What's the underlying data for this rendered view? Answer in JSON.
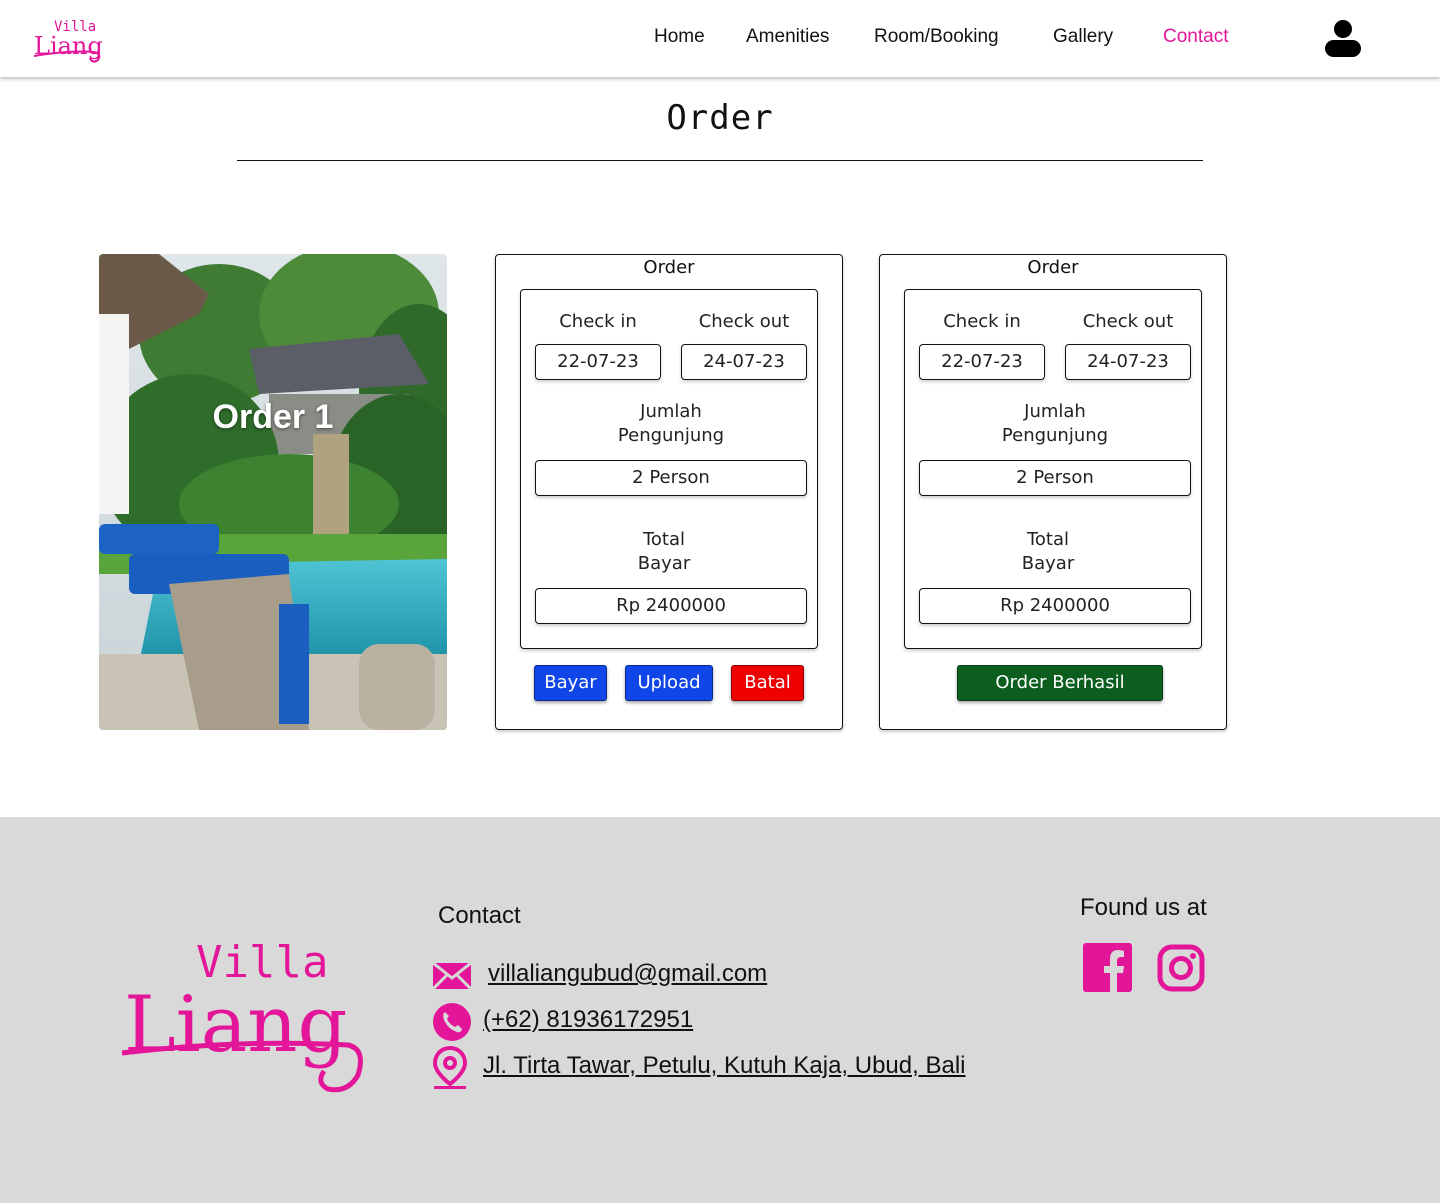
{
  "brand": {
    "logo_line1": "Villa",
    "logo_line2": "Liang",
    "accent": "#e3169a"
  },
  "nav": {
    "items": [
      {
        "label": "Home"
      },
      {
        "label": "Amenities"
      },
      {
        "label": "Room/Booking"
      },
      {
        "label": "Gallery"
      },
      {
        "label": "Contact"
      }
    ],
    "active": "Contact",
    "user_icon": "user-icon"
  },
  "page": {
    "title": "Order"
  },
  "image_card": {
    "label": "Order 1",
    "image": "villa-pool-photo"
  },
  "orders": [
    {
      "title": "Order",
      "check_in_label": "Check in",
      "check_out_label": "Check out",
      "check_in": "22-07-23",
      "check_out": "24-07-23",
      "guests_label_1": "Jumlah",
      "guests_label_2": "Pengunjung",
      "guests": "2 Person",
      "total_label_1": "Total",
      "total_label_2": "Bayar",
      "total": "Rp 2400000",
      "buttons": [
        {
          "label": "Bayar",
          "color": "#1045e8"
        },
        {
          "label": "Upload",
          "color": "#1045e8"
        },
        {
          "label": "Batal",
          "color": "#ee0000"
        }
      ]
    },
    {
      "title": "Order",
      "check_in_label": "Check in",
      "check_out_label": "Check out",
      "check_in": "22-07-23",
      "check_out": "24-07-23",
      "guests_label_1": "Jumlah",
      "guests_label_2": "Pengunjung",
      "guests": "2 Person",
      "total_label_1": "Total",
      "total_label_2": "Bayar",
      "total": "Rp 2400000",
      "status_button": {
        "label": "Order Berhasil",
        "color": "#0b5e1e"
      }
    }
  ],
  "footer": {
    "contact_heading": "Contact",
    "email": "villaliangubud@gmail.com",
    "phone": "(+62) 81936172951",
    "address": "Jl. Tirta Tawar, Petulu, Kutuh Kaja, Ubud, Bali",
    "found_heading": "Found us at",
    "icons": [
      "mail-icon",
      "phone-icon",
      "location-pin-icon",
      "facebook-icon",
      "instagram-icon"
    ],
    "background": "#d9d9d9"
  }
}
